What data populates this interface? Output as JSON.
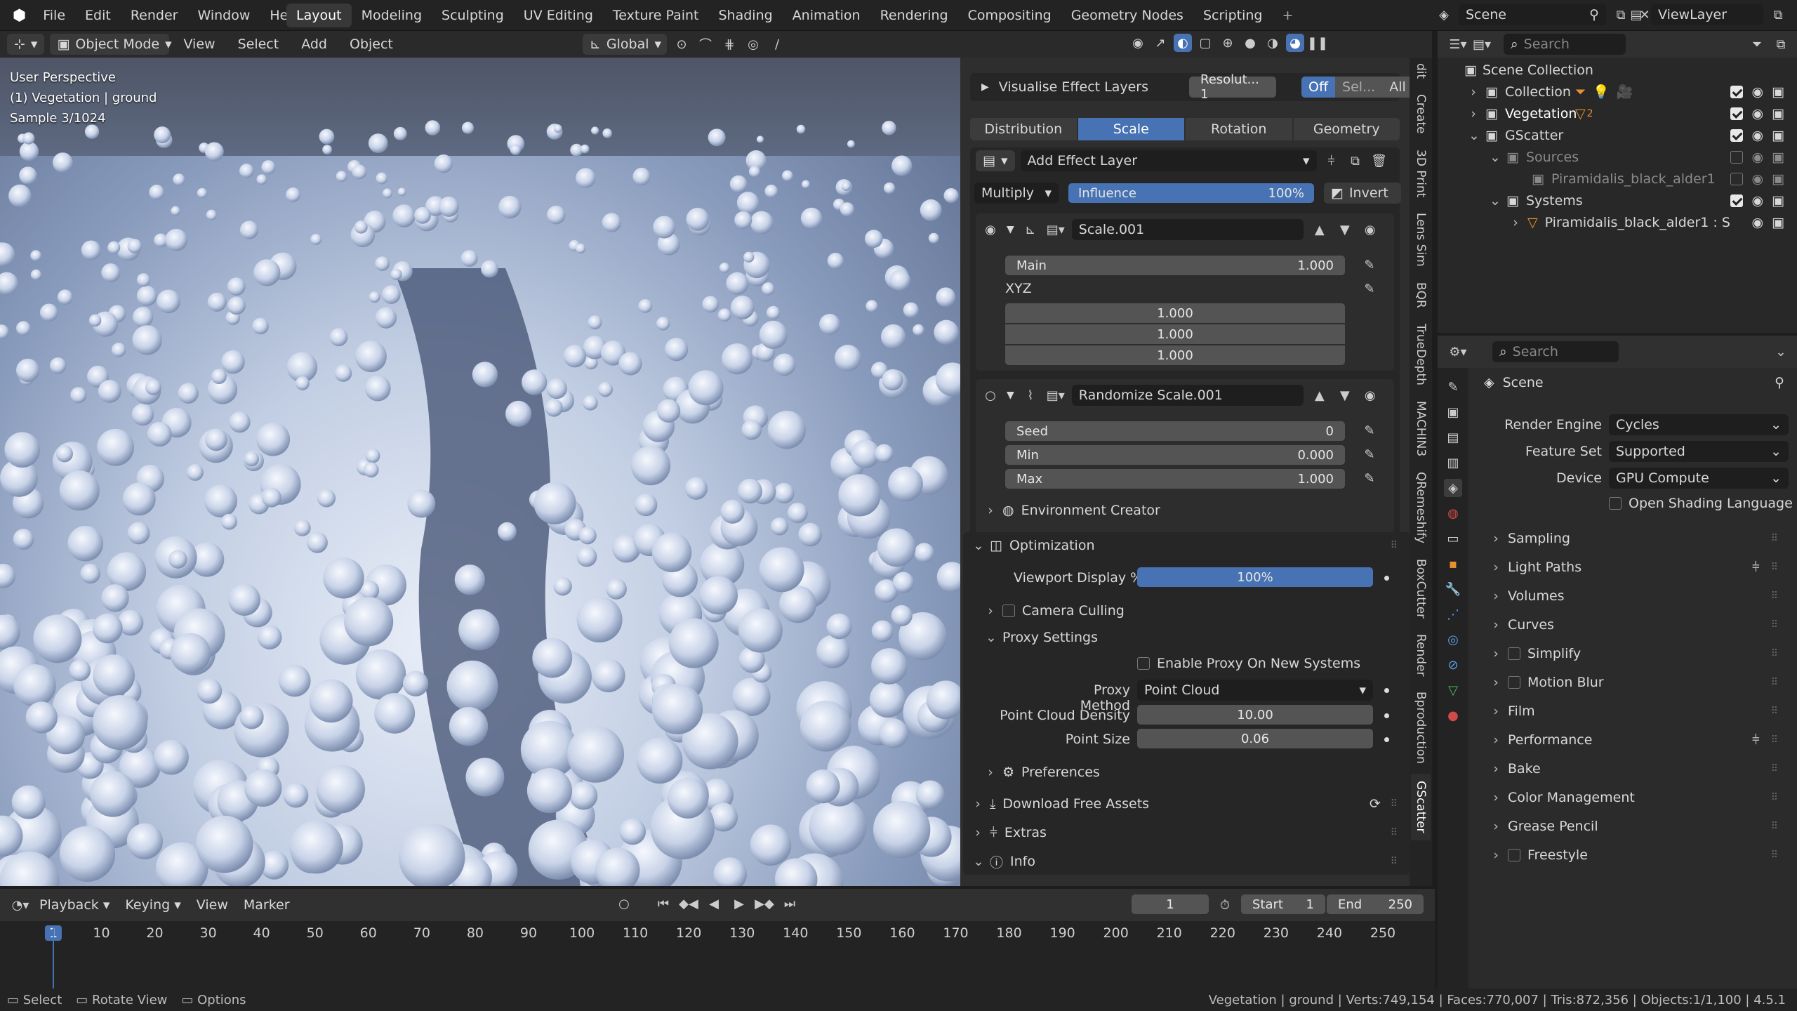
{
  "menu": {
    "file": "File",
    "edit": "Edit",
    "render": "Render",
    "window": "Window",
    "help": "Help"
  },
  "workspaces": [
    "Layout",
    "Modeling",
    "Sculpting",
    "UV Editing",
    "Texture Paint",
    "Shading",
    "Animation",
    "Rendering",
    "Compositing",
    "Geometry Nodes",
    "Scripting"
  ],
  "topright": {
    "scene": "Scene",
    "viewlayer": "ViewLayer"
  },
  "viewport_header": {
    "mode": "Object Mode",
    "view": "View",
    "select": "Select",
    "add": "Add",
    "object": "Object",
    "orientation": "Global"
  },
  "viewport_overlay": {
    "line1": "User Perspective",
    "line2": "(1) Vegetation | ground",
    "line3": "Sample 3/1024"
  },
  "gscatter": {
    "visualise": "Visualise Effect Layers",
    "resolution": "Resolut... 1",
    "off": "Off",
    "sel": "Sel...",
    "all": "All",
    "tabs": [
      "Distribution",
      "Scale",
      "Rotation",
      "Geometry"
    ],
    "add_effect_layer": "Add Effect Layer",
    "blend": "Multiply",
    "influence_label": "Influence",
    "influence_value": "100%",
    "invert": "Invert",
    "layer1": {
      "name": "Scale.001",
      "main_label": "Main",
      "main_value": "1.000",
      "xyz_label": "XYZ",
      "xyz": [
        "1.000",
        "1.000",
        "1.000"
      ]
    },
    "layer2": {
      "name": "Randomize Scale.001",
      "seed_label": "Seed",
      "seed_value": "0",
      "min_label": "Min",
      "min_value": "0.000",
      "max_label": "Max",
      "max_value": "1.000"
    },
    "env_creator": "Environment Creator",
    "optimization": "Optimization",
    "viewport_display_label": "Viewport Display %",
    "viewport_display_value": "100%",
    "camera_culling": "Camera Culling",
    "proxy_settings": "Proxy Settings",
    "enable_proxy": "Enable Proxy On New Systems",
    "proxy_method_label": "Proxy Method",
    "proxy_method_value": "Point Cloud",
    "pc_density_label": "Point Cloud Density",
    "pc_density_value": "10.00",
    "point_size_label": "Point Size",
    "point_size_value": "0.06",
    "preferences": "Preferences",
    "download": "Download Free Assets",
    "extras": "Extras",
    "info": "Info"
  },
  "side_tabs": [
    "dit",
    "Create",
    "3D Print",
    "Lens Sim",
    "BQR",
    "TrueDepth",
    "MACHIN3",
    "QRemeshify",
    "BoxCutter",
    "Render",
    "Bproduction",
    "GScatter"
  ],
  "outliner": {
    "search_placeholder": "Search",
    "scene_collection": "Scene Collection",
    "collection": "Collection",
    "vegetation": "Vegetation",
    "vegetation_badge": "2",
    "gscatter": "GScatter",
    "sources": "Sources",
    "source_item": "Piramidalis_black_alder1",
    "systems": "Systems",
    "system_item": "Piramidalis_black_alder1 : S"
  },
  "properties": {
    "search_placeholder": "Search",
    "scene": "Scene",
    "render_engine_label": "Render Engine",
    "render_engine": "Cycles",
    "feature_set_label": "Feature Set",
    "feature_set": "Supported",
    "device_label": "Device",
    "device": "GPU Compute",
    "osl": "Open Shading Language",
    "panels": [
      "Sampling",
      "Light Paths",
      "Volumes",
      "Curves",
      "Simplify",
      "Motion Blur",
      "Film",
      "Performance",
      "Bake",
      "Color Management",
      "Grease Pencil",
      "Freestyle"
    ]
  },
  "timeline": {
    "playback": "Playback",
    "keying": "Keying",
    "view": "View",
    "marker": "Marker",
    "current_frame": "1",
    "start_label": "Start",
    "start": "1",
    "end_label": "End",
    "end": "250",
    "ticks": [
      "1",
      "10",
      "20",
      "30",
      "40",
      "50",
      "60",
      "70",
      "80",
      "90",
      "100",
      "110",
      "120",
      "130",
      "140",
      "150",
      "160",
      "170",
      "180",
      "190",
      "200",
      "210",
      "220",
      "230",
      "240",
      "250"
    ]
  },
  "statusbar": {
    "select": "Select",
    "rotate": "Rotate View",
    "options": "Options",
    "info": "Vegetation | ground | Verts:749,154 | Faces:770,007 | Tris:872,356 | Objects:1/1,100 | 4.5.1"
  },
  "colors": {
    "accent": "#4772b3",
    "orange": "#e8922d",
    "panel": "#2b2b2b"
  }
}
